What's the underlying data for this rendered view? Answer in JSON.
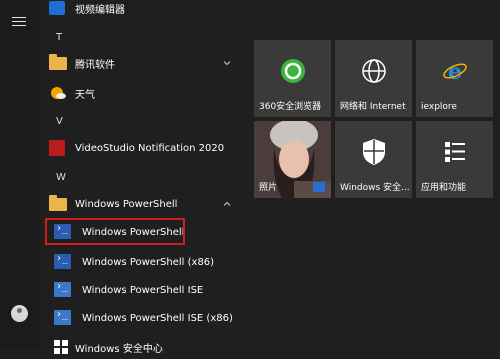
{
  "list": {
    "top_item": "视频编辑器",
    "letters": {
      "t": "T",
      "v": "V",
      "w": "W"
    },
    "items": {
      "tencent": "腾讯软件",
      "weather": "天气",
      "videostudio": "VideoStudio Notification 2020",
      "ps_folder": "Windows PowerShell",
      "ps": "Windows PowerShell",
      "ps86": "Windows PowerShell (x86)",
      "ise": "Windows PowerShell ISE",
      "ise86": "Windows PowerShell ISE (x86)",
      "security_center": "Windows 安全中心"
    }
  },
  "tiles": {
    "browser360": "360安全浏览器",
    "network": "网络和 Internet",
    "iexplore": "iexplore",
    "photos": "照片",
    "security": "Windows 安全...",
    "apps": "应用和功能"
  },
  "colors": {
    "highlight": "#d01e1e",
    "tile": "#3a3a3a",
    "background": "#1f1f1f"
  }
}
